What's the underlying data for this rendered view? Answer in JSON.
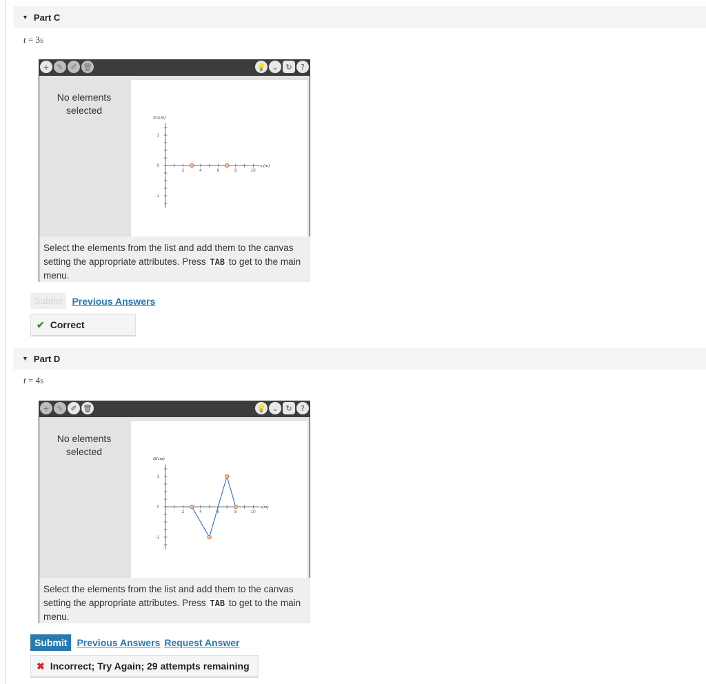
{
  "parts": [
    {
      "header": "Part C",
      "time": {
        "t": "t",
        "eq": " = ",
        "value": "3",
        "unit": "s"
      },
      "toolbar_icons": [
        "add-icon",
        "pencil-icon",
        "pencil-plus-icon",
        "trash-icon",
        "hint-icon",
        "dropdown-icon",
        "reset-icon",
        "help-icon"
      ],
      "toolbar_glyphs": {
        "add": "+",
        "pencil": "✎",
        "pencil_plus": "✐",
        "trash": "🗑",
        "hint": "💡",
        "dropdown": "⌄",
        "reset": "↻",
        "help": "?"
      },
      "no_elements": "No elements selected",
      "instructions_pre": "Select the elements from the list and add them to the canvas setting the appropriate attributes. Press ",
      "instructions_key": "TAB",
      "instructions_post": " to get to the main menu.",
      "submit_label": "Submit",
      "previous_answers": "Previous Answers",
      "feedback_icon": "check-icon",
      "feedback_glyph": "✔",
      "feedback_text": "Correct"
    },
    {
      "header": "Part D",
      "time": {
        "t": "t",
        "eq": " = ",
        "value": "4",
        "unit": "s"
      },
      "toolbar_glyphs": {
        "add": "+",
        "pencil": "✎",
        "pencil_plus": "✐",
        "trash": "🗑",
        "hint": "💡",
        "dropdown": "⌄",
        "reset": "↻",
        "help": "?"
      },
      "no_elements": "No elements selected",
      "instructions_pre": "Select the elements from the list and add them to the canvas setting the appropriate attributes. Press ",
      "instructions_key": "TAB",
      "instructions_post": " to get to the main menu.",
      "submit_label": "Submit",
      "previous_answers": "Previous Answers",
      "request_answer": "Request Answer",
      "feedback_icon": "x-icon",
      "feedback_glyph": "✖",
      "feedback_text": "Incorrect; Try Again; 29 attempts remaining"
    }
  ],
  "colors": {
    "line": "#2f6fc0",
    "point": "#d05a2a",
    "link": "#2a7ab0",
    "correct": "#3c8f2e",
    "incorrect": "#d32525"
  },
  "chart_data": [
    {
      "type": "line",
      "xlabel": "x (m)",
      "ylabel": "D (cm)",
      "x_ticks": [
        "2",
        "4",
        "6",
        "8",
        "10"
      ],
      "y_ticks": [
        "1",
        "0",
        "-1"
      ],
      "xlim": [
        0,
        11
      ],
      "ylim": [
        -1.5,
        1.5
      ],
      "points": [
        [
          3,
          0
        ],
        [
          7,
          0
        ]
      ]
    },
    {
      "type": "line",
      "xlabel": "x(m)",
      "ylabel": "D(cm)",
      "x_ticks": [
        "2",
        "4",
        "6",
        "8",
        "10"
      ],
      "y_ticks": [
        "1",
        "0",
        "-1"
      ],
      "xlim": [
        0,
        11
      ],
      "ylim": [
        -1.5,
        1.5
      ],
      "points": [
        [
          3,
          0
        ],
        [
          5,
          -1
        ],
        [
          7,
          1
        ],
        [
          8,
          0
        ]
      ]
    }
  ]
}
